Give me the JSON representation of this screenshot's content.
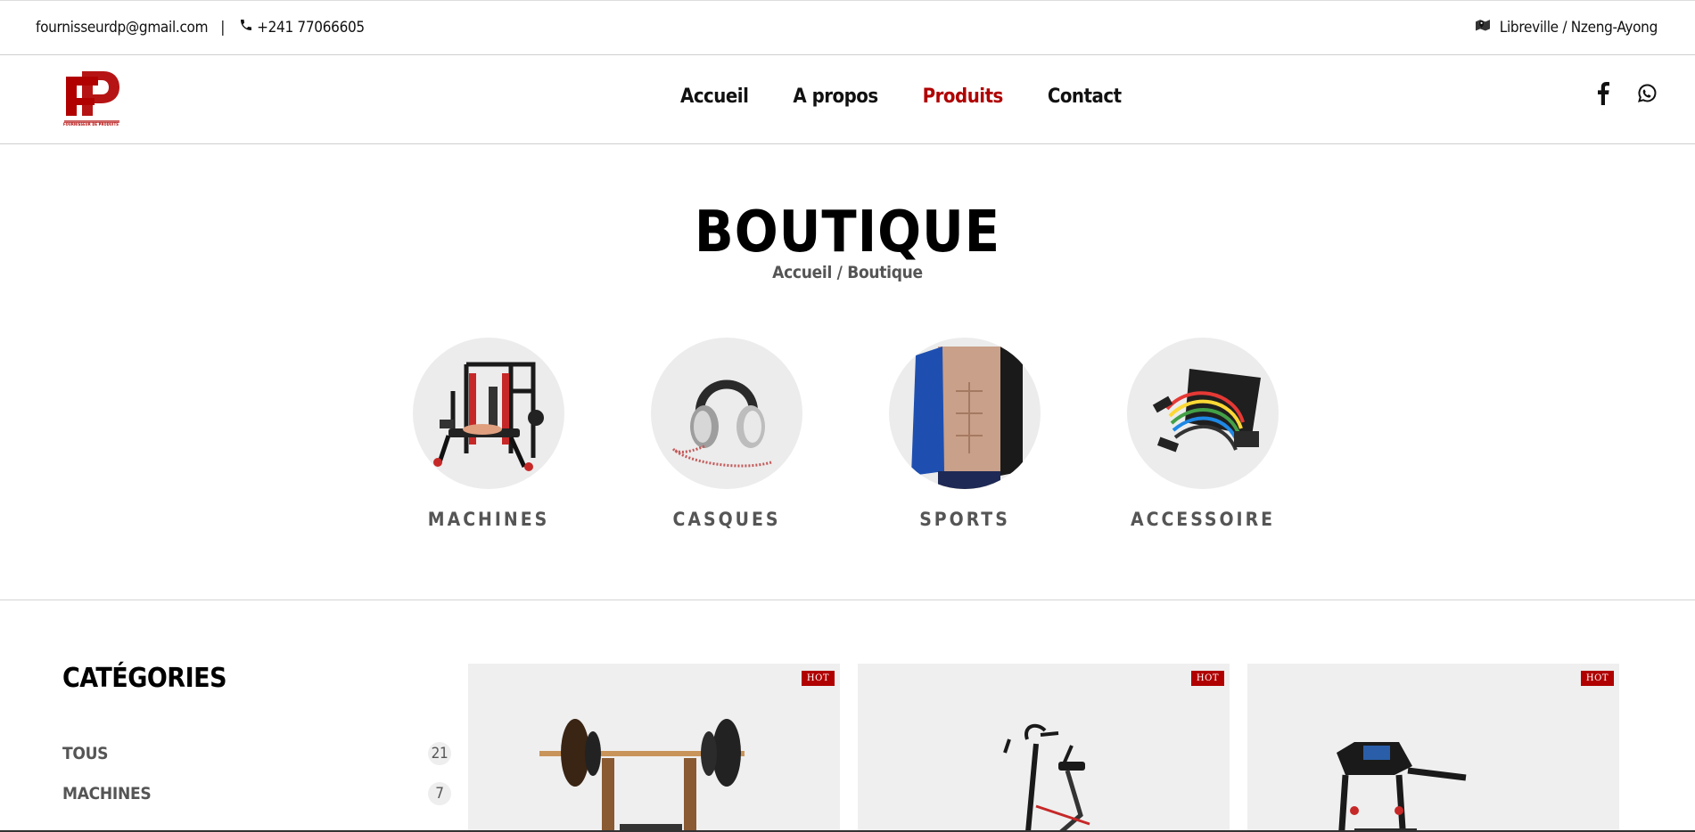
{
  "topbar": {
    "email": "fournisseurdp@gmail.com",
    "separator": "|",
    "phone": "+241 77066605",
    "location": "Libreville / Nzeng-Ayong"
  },
  "brand": {
    "logo_caption": "FOURNISSEUR DE PRODUITS"
  },
  "nav": {
    "items": [
      {
        "label": "Accueil"
      },
      {
        "label": "A propos"
      },
      {
        "label": "Produits"
      },
      {
        "label": "Contact"
      }
    ],
    "active_color": "#b00000"
  },
  "hero": {
    "title": "BOUTIQUE",
    "breadcrumb": "Accueil / Boutique"
  },
  "categories_showcase": [
    {
      "label": "MACHINES"
    },
    {
      "label": "CASQUES"
    },
    {
      "label": "SPORTS"
    },
    {
      "label": "ACCESSOIRE"
    }
  ],
  "sidebar": {
    "title": "CATÉGORIES",
    "items": [
      {
        "label": "TOUS",
        "count": "21"
      },
      {
        "label": "MACHINES",
        "count": "7"
      }
    ]
  },
  "products": [
    {
      "badge": "HOT"
    },
    {
      "badge": "HOT"
    },
    {
      "badge": "HOT"
    }
  ]
}
